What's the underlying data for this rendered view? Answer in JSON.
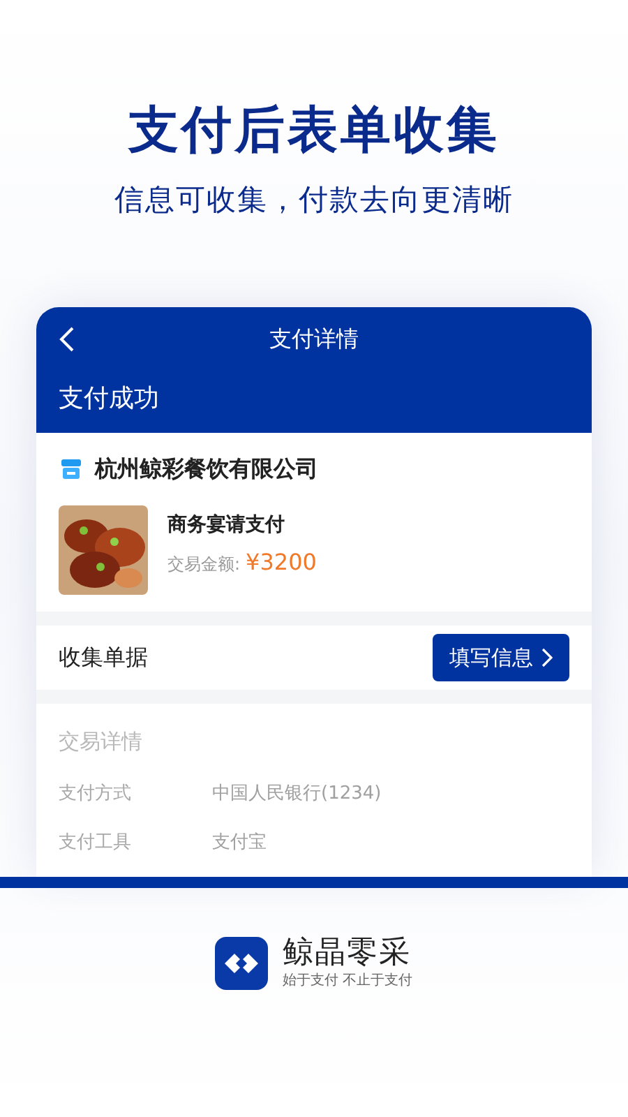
{
  "headline": "支付后表单收集",
  "subtitle": "信息可收集，付款去向更清晰",
  "phone": {
    "nav_title": "支付详情",
    "status": "支付成功",
    "merchant": "杭州鲸彩餐饮有限公司",
    "order": {
      "kind": "picture",
      "title": "商务宴请支付",
      "amount_label": "交易金额:",
      "amount": "¥3200"
    },
    "collect": {
      "label": "收集单据",
      "button": "填写信息"
    },
    "details": {
      "title": "交易详情",
      "rows": [
        {
          "label": "支付方式",
          "value": "中国人民银行(1234)"
        },
        {
          "label": "支付工具",
          "value": "支付宝"
        }
      ]
    }
  },
  "brand": {
    "name": "鲸晶零采",
    "tagline": "始于支付 不止于支付"
  }
}
